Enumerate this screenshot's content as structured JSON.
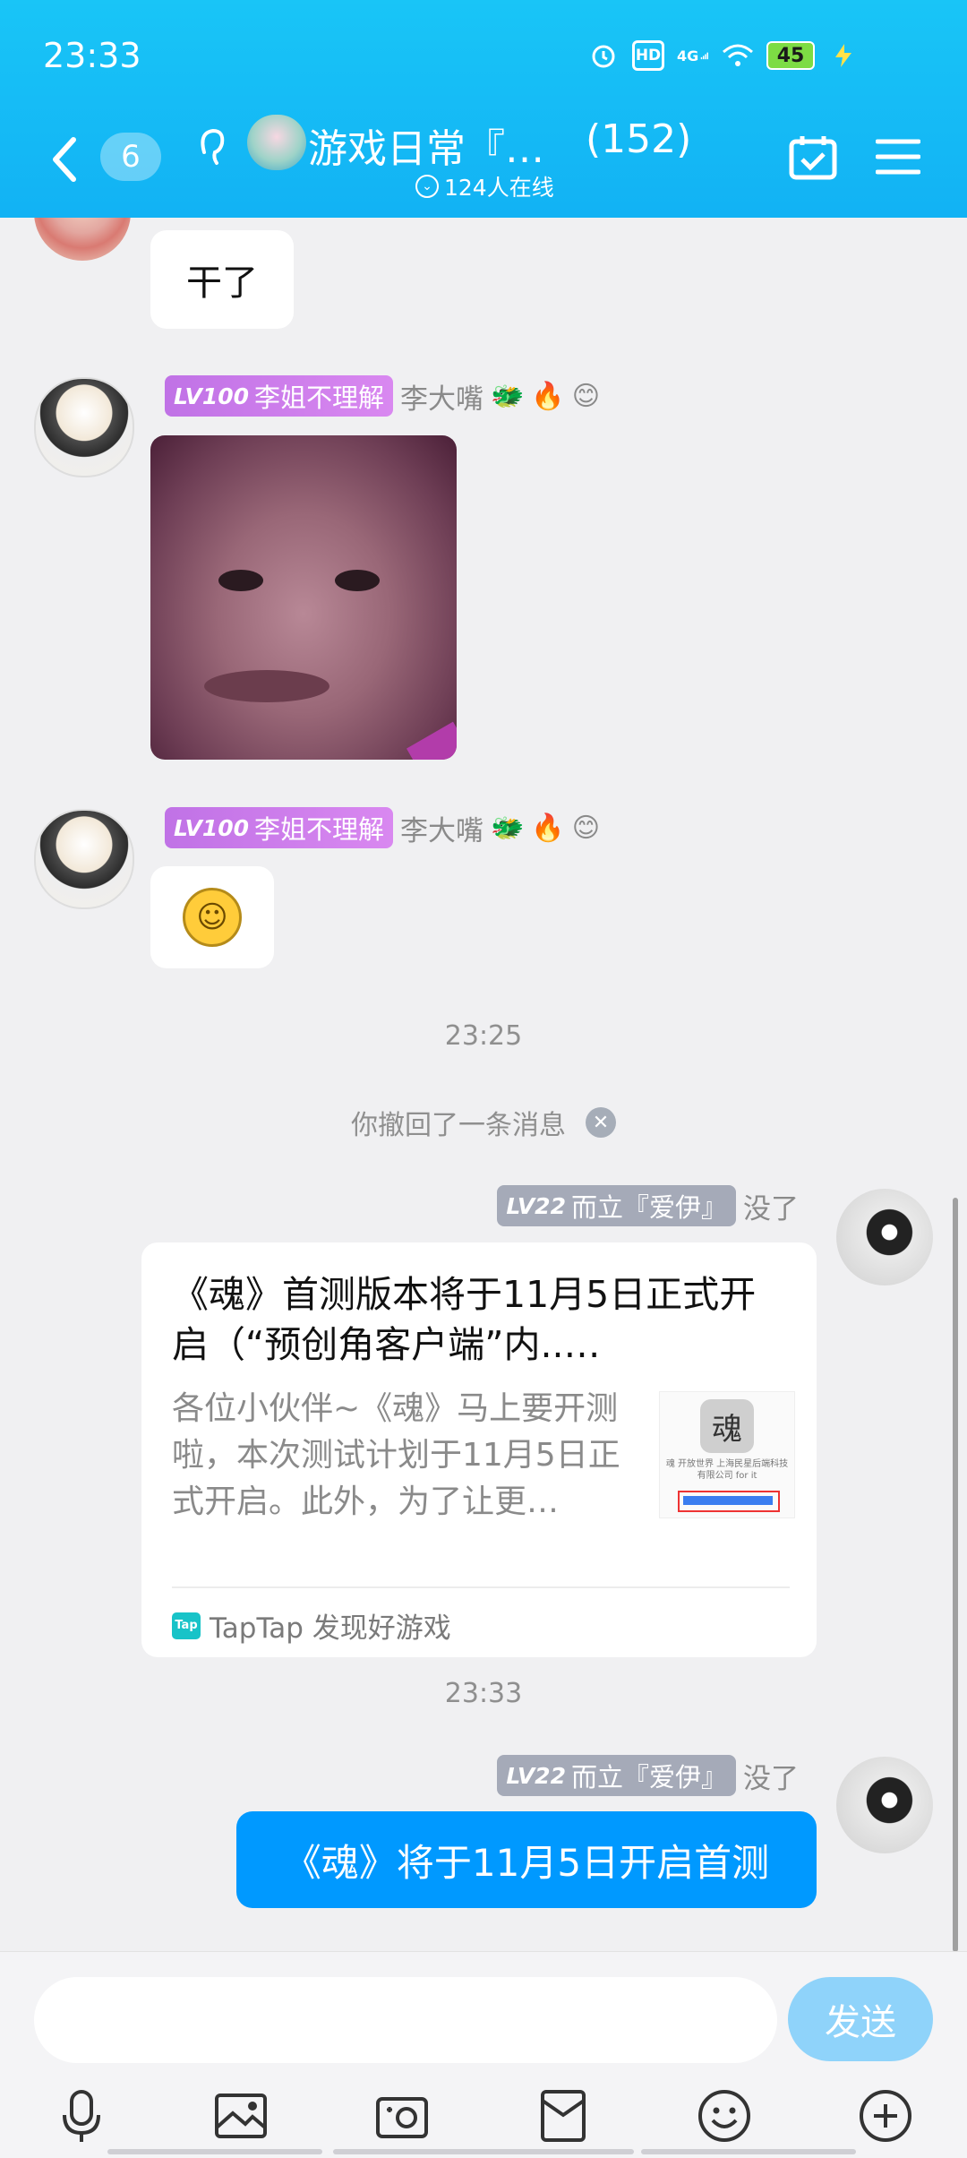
{
  "status_bar": {
    "time": "23:33",
    "hd": "HD",
    "net": "4G",
    "battery": "45"
  },
  "header": {
    "back_badge": "6",
    "title": "游戏日常『…",
    "member_count": "(152)",
    "online": "124人在线"
  },
  "messages": {
    "top_text": "干了",
    "sender1": {
      "level": "LV100",
      "title": "李姐不理解",
      "name": "李大嘴",
      "badges": [
        "🐲",
        "🔥",
        "😊"
      ]
    },
    "time1": "23:25",
    "recall_text": "你撤回了一条消息",
    "sender_me": {
      "level": "LV22",
      "title": "而立『爱伊』",
      "name": "没了"
    },
    "card": {
      "title": "《魂》首测版本将于11月5日正式开启（“预创角客户端”内..…",
      "desc": "各位小伙伴~《魂》马上要开测啦，本次测试计划于11月5日正式开启。此外，为了让更…",
      "thumb_logo": "魂",
      "thumb_text": "魂 开放世界 上海民星后端科技有限公司 for it",
      "source_icon": "Tap",
      "source": "TapTap 发现好游戏"
    },
    "time2": "23:33",
    "me_text": "《魂》将于11月5日开启首测"
  },
  "input": {
    "placeholder": "",
    "send_label": "发送"
  },
  "toolbar_icons": [
    "microphone-icon",
    "image-icon",
    "camera-icon",
    "red-packet-icon",
    "emoji-icon",
    "plus-icon"
  ],
  "colors": {
    "header": "#12b2f4",
    "my_bubble": "#0099ff",
    "send_button": "#8fd3fa"
  }
}
